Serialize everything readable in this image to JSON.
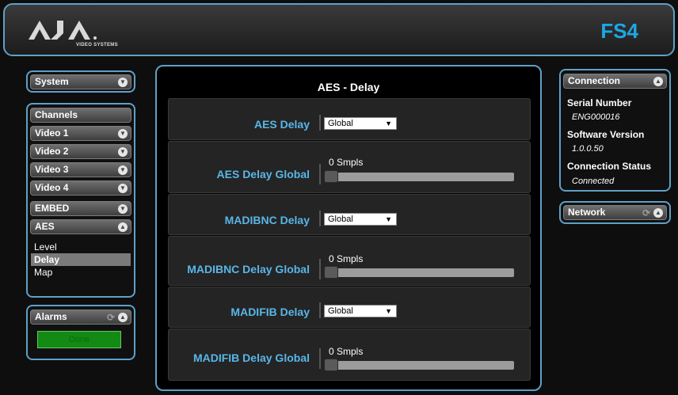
{
  "brand": {
    "logo_text": "AJA",
    "logo_sub": "VIDEO SYSTEMS",
    "model": "FS4"
  },
  "sidebar": {
    "system": {
      "label": "System"
    },
    "channels": {
      "header": "Channels",
      "items": [
        {
          "label": "Video 1"
        },
        {
          "label": "Video 2"
        },
        {
          "label": "Video 3"
        },
        {
          "label": "Video 4"
        },
        {
          "label": "EMBED"
        },
        {
          "label": "AES"
        }
      ],
      "sub_items": [
        {
          "label": "Level",
          "active": false
        },
        {
          "label": "Delay",
          "active": true
        },
        {
          "label": "Map",
          "active": false
        }
      ]
    },
    "alarms": {
      "label": "Alarms",
      "status": "Done"
    }
  },
  "main": {
    "title": "AES - Delay",
    "rows": [
      {
        "label": "AES Delay",
        "type": "select",
        "value": "Global"
      },
      {
        "label": "AES Delay Global",
        "type": "slider",
        "value": "0 Smpls"
      },
      {
        "label": "MADIBNC Delay",
        "type": "select",
        "value": "Global"
      },
      {
        "label": "MADIBNC Delay Global",
        "type": "slider",
        "value": "0 Smpls"
      },
      {
        "label": "MADIFIB Delay",
        "type": "select",
        "value": "Global"
      },
      {
        "label": "MADIFIB Delay Global",
        "type": "slider",
        "value": "0 Smpls"
      }
    ]
  },
  "connection": {
    "title": "Connection",
    "serial_label": "Serial Number",
    "serial_value": "ENG000016",
    "software_label": "Software Version",
    "software_value": "1.0.0.50",
    "status_label": "Connection Status",
    "status_value": "Connected"
  },
  "network": {
    "title": "Network"
  },
  "colors": {
    "accent": "#5ea0c8",
    "label_blue": "#59b6e8",
    "model_blue": "#1da7e3",
    "done_green": "#138a13"
  }
}
